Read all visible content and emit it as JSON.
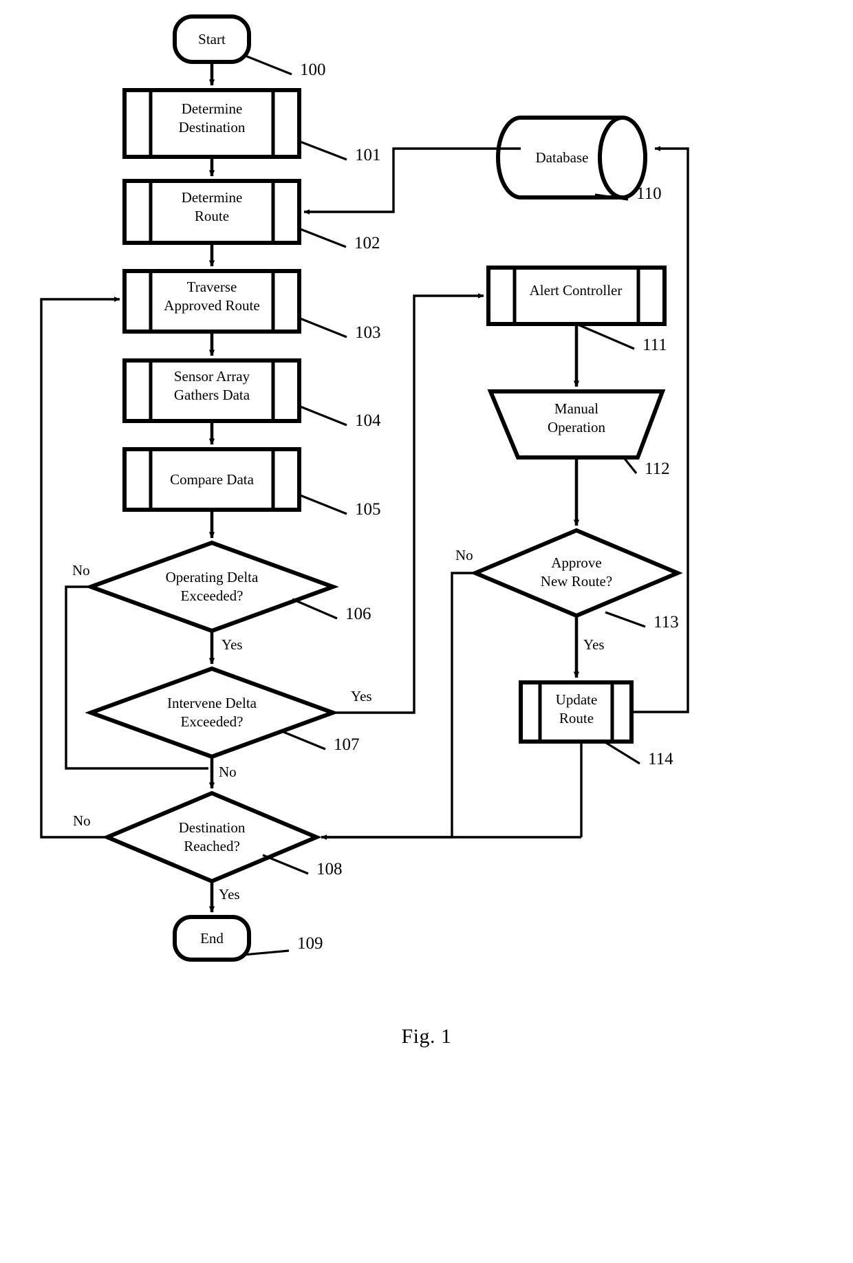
{
  "figure": {
    "caption": "Fig. 1",
    "type": "patent-flowchart"
  },
  "nodes": [
    {
      "id": "n100",
      "ref": "100",
      "label": "Start",
      "shape": "terminator"
    },
    {
      "id": "n101",
      "ref": "101",
      "label": "Determine\nDestination",
      "shape": "predefined-process"
    },
    {
      "id": "n102",
      "ref": "102",
      "label": "Determine\nRoute",
      "shape": "predefined-process"
    },
    {
      "id": "n103",
      "ref": "103",
      "label": "Traverse\nApproved Route",
      "shape": "predefined-process"
    },
    {
      "id": "n104",
      "ref": "104",
      "label": "Sensor Array\nGathers Data",
      "shape": "predefined-process"
    },
    {
      "id": "n105",
      "ref": "105",
      "label": "Compare Data",
      "shape": "predefined-process"
    },
    {
      "id": "n106",
      "ref": "106",
      "label": "Operating Delta\nExceeded?",
      "shape": "decision"
    },
    {
      "id": "n107",
      "ref": "107",
      "label": "Intervene Delta\nExceeded?",
      "shape": "decision"
    },
    {
      "id": "n108",
      "ref": "108",
      "label": "Destination\nReached?",
      "shape": "decision"
    },
    {
      "id": "n109",
      "ref": "109",
      "label": "End",
      "shape": "terminator"
    },
    {
      "id": "n110",
      "ref": "110",
      "label": "Database",
      "shape": "database"
    },
    {
      "id": "n111",
      "ref": "111",
      "label": "Alert Controller",
      "shape": "predefined-process"
    },
    {
      "id": "n112",
      "ref": "112",
      "label": "Manual\nOperation",
      "shape": "manual-operation"
    },
    {
      "id": "n113",
      "ref": "113",
      "label": "Approve\nNew Route?",
      "shape": "decision"
    },
    {
      "id": "n114",
      "ref": "114",
      "label": "Update\nRoute",
      "shape": "predefined-process"
    }
  ],
  "edge_labels": [
    {
      "id": "e106-no",
      "text": "No",
      "from": "n106",
      "to": "n108"
    },
    {
      "id": "e106-yes",
      "text": "Yes",
      "from": "n106",
      "to": "n107"
    },
    {
      "id": "e107-yes",
      "text": "Yes",
      "from": "n107",
      "to": "n111"
    },
    {
      "id": "e107-no",
      "text": "No",
      "from": "n107",
      "to": "n108"
    },
    {
      "id": "e108-no",
      "text": "No",
      "from": "n108",
      "to": "n103"
    },
    {
      "id": "e108-yes",
      "text": "Yes",
      "from": "n108",
      "to": "n109"
    },
    {
      "id": "e113-no",
      "text": "No",
      "from": "n113",
      "to": "n108"
    },
    {
      "id": "e113-yes",
      "text": "Yes",
      "from": "n113",
      "to": "n114"
    }
  ],
  "colors": {
    "stroke": "#000000",
    "fill": "#ffffff",
    "background": "#ffffff"
  }
}
